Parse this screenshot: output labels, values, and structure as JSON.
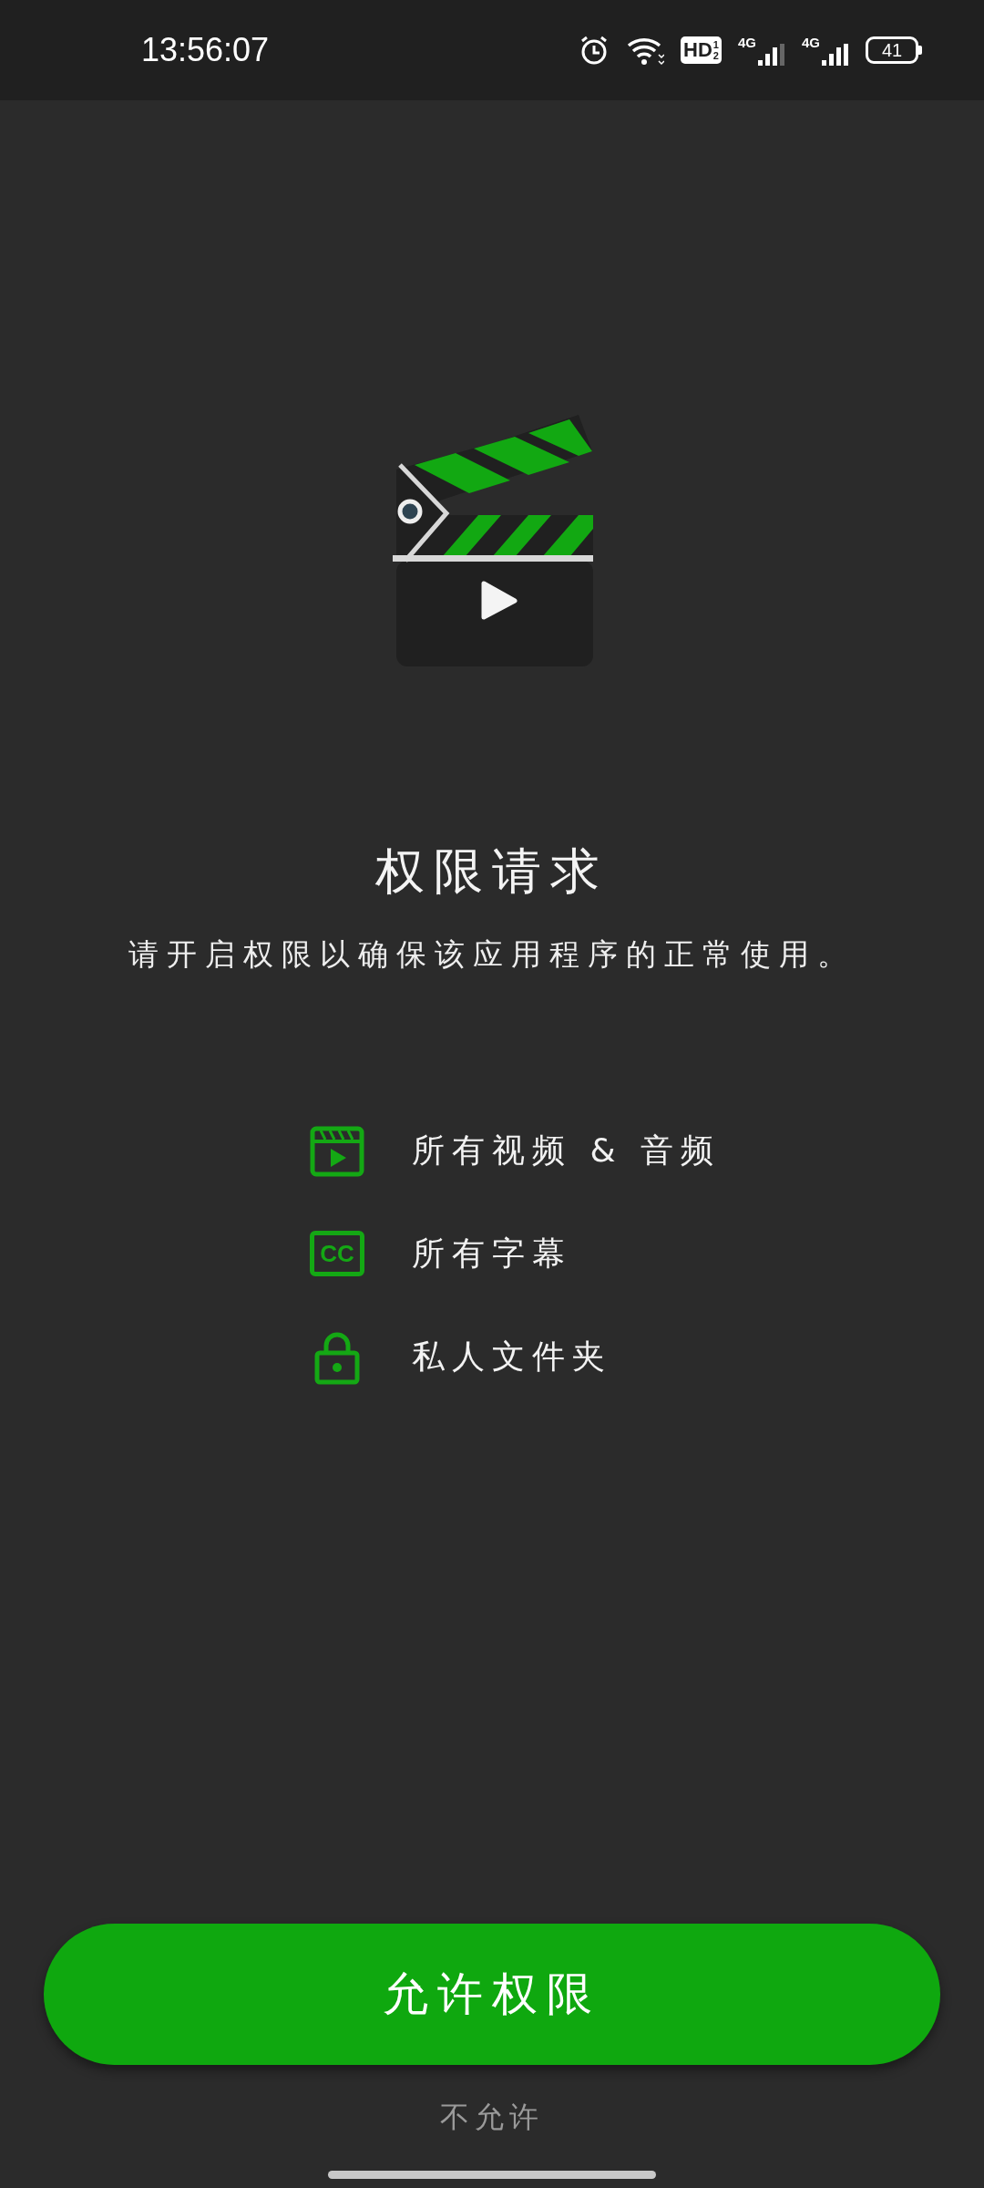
{
  "status_bar": {
    "time": "13:56:07",
    "hd_label": "HD",
    "hd_fraction": [
      "1",
      "2"
    ],
    "sim_labels": [
      "4G",
      "4G"
    ],
    "battery": "41"
  },
  "title": "权限请求",
  "subtitle": "请开启权限以确保该应用程序的正常使用。",
  "permissions": [
    {
      "kind": "video",
      "label": "所有视频 & 音频"
    },
    {
      "kind": "subtitles",
      "icon_text": "CC",
      "label": "所有字幕"
    },
    {
      "kind": "lock",
      "label": "私人文件夹"
    }
  ],
  "allow_button": "允许权限",
  "deny_link": "不允许"
}
